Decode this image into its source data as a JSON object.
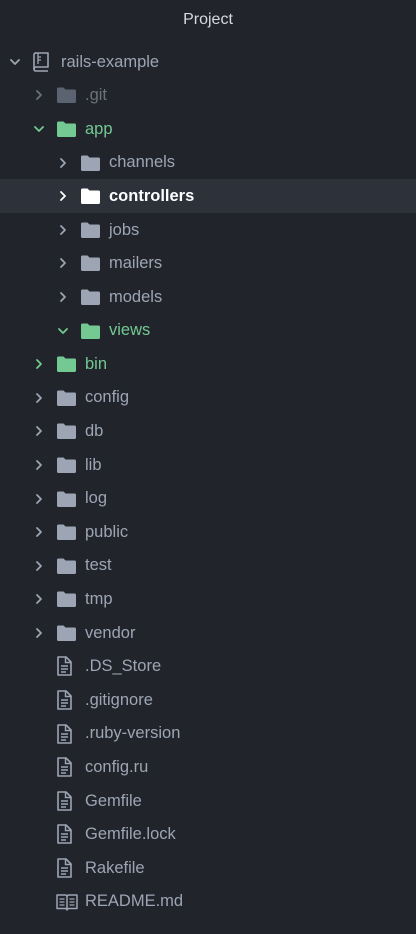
{
  "panel": {
    "title": "Project"
  },
  "colors": {
    "background": "#21252b",
    "selected_row": "#2c313a",
    "text": "#9da5b4",
    "dim_text": "#6b717d",
    "modified_green": "#73c991",
    "folder_gray": "#9da5b4"
  },
  "tree": [
    {
      "label": "rails-example",
      "kind": "repo",
      "expanded": true,
      "depth": 0,
      "icon": "repo-icon",
      "status": "normal"
    },
    {
      "label": ".git",
      "kind": "folder",
      "expanded": false,
      "depth": 1,
      "icon": "folder-icon",
      "status": "ignored"
    },
    {
      "label": "app",
      "kind": "folder",
      "expanded": true,
      "depth": 1,
      "icon": "folder-icon",
      "status": "modified"
    },
    {
      "label": "channels",
      "kind": "folder",
      "expanded": false,
      "depth": 2,
      "icon": "folder-icon",
      "status": "normal"
    },
    {
      "label": "controllers",
      "kind": "folder",
      "expanded": false,
      "depth": 2,
      "icon": "folder-icon",
      "status": "selected"
    },
    {
      "label": "jobs",
      "kind": "folder",
      "expanded": false,
      "depth": 2,
      "icon": "folder-icon",
      "status": "normal"
    },
    {
      "label": "mailers",
      "kind": "folder",
      "expanded": false,
      "depth": 2,
      "icon": "folder-icon",
      "status": "normal"
    },
    {
      "label": "models",
      "kind": "folder",
      "expanded": false,
      "depth": 2,
      "icon": "folder-icon",
      "status": "normal"
    },
    {
      "label": "views",
      "kind": "folder",
      "expanded": true,
      "depth": 2,
      "icon": "folder-icon",
      "status": "modified"
    },
    {
      "label": "bin",
      "kind": "folder",
      "expanded": false,
      "depth": 1,
      "icon": "folder-icon",
      "status": "modified"
    },
    {
      "label": "config",
      "kind": "folder",
      "expanded": false,
      "depth": 1,
      "icon": "folder-icon",
      "status": "normal"
    },
    {
      "label": "db",
      "kind": "folder",
      "expanded": false,
      "depth": 1,
      "icon": "folder-icon",
      "status": "normal"
    },
    {
      "label": "lib",
      "kind": "folder",
      "expanded": false,
      "depth": 1,
      "icon": "folder-icon",
      "status": "normal"
    },
    {
      "label": "log",
      "kind": "folder",
      "expanded": false,
      "depth": 1,
      "icon": "folder-icon",
      "status": "normal"
    },
    {
      "label": "public",
      "kind": "folder",
      "expanded": false,
      "depth": 1,
      "icon": "folder-icon",
      "status": "normal"
    },
    {
      "label": "test",
      "kind": "folder",
      "expanded": false,
      "depth": 1,
      "icon": "folder-icon",
      "status": "normal"
    },
    {
      "label": "tmp",
      "kind": "folder",
      "expanded": false,
      "depth": 1,
      "icon": "folder-icon",
      "status": "normal"
    },
    {
      "label": "vendor",
      "kind": "folder",
      "expanded": false,
      "depth": 1,
      "icon": "folder-icon",
      "status": "normal"
    },
    {
      "label": ".DS_Store",
      "kind": "file",
      "depth": 1,
      "icon": "file-icon",
      "status": "normal"
    },
    {
      "label": ".gitignore",
      "kind": "file",
      "depth": 1,
      "icon": "file-icon",
      "status": "normal"
    },
    {
      "label": ".ruby-version",
      "kind": "file",
      "depth": 1,
      "icon": "file-icon",
      "status": "normal"
    },
    {
      "label": "config.ru",
      "kind": "file",
      "depth": 1,
      "icon": "file-icon",
      "status": "normal"
    },
    {
      "label": "Gemfile",
      "kind": "file",
      "depth": 1,
      "icon": "file-icon",
      "status": "normal"
    },
    {
      "label": "Gemfile.lock",
      "kind": "file",
      "depth": 1,
      "icon": "file-icon",
      "status": "normal"
    },
    {
      "label": "Rakefile",
      "kind": "file",
      "depth": 1,
      "icon": "file-icon",
      "status": "normal"
    },
    {
      "label": "README.md",
      "kind": "file",
      "depth": 1,
      "icon": "book-icon",
      "status": "normal"
    }
  ]
}
